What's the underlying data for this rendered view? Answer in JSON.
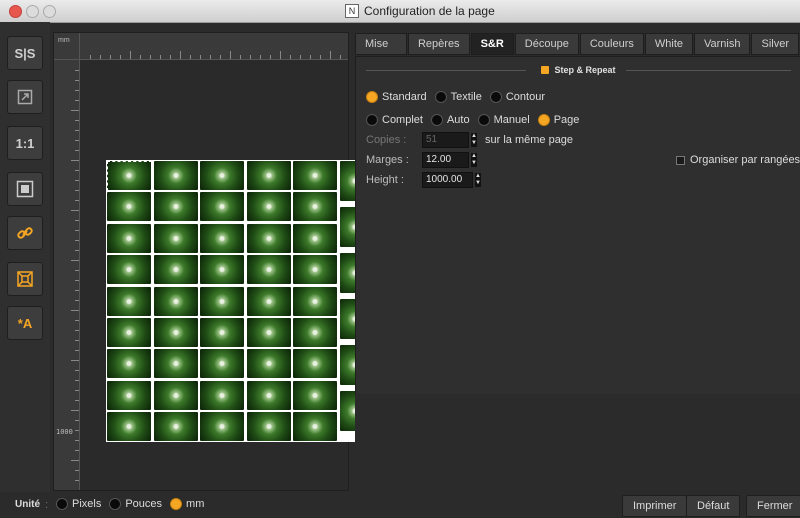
{
  "window": {
    "title": "Configuration de la page",
    "app_icon_glyph": "N"
  },
  "toolbar": {
    "buttons": [
      {
        "name": "split-view-icon",
        "glyph": "S|S",
        "color": "#d0d0d0"
      },
      {
        "name": "export-icon",
        "glyph": "⇱",
        "color": "#aaaaaa"
      },
      {
        "name": "actual-size-icon",
        "glyph": "1:1",
        "color": "#d0d0d0"
      },
      {
        "name": "fit-page-icon",
        "glyph": "▣",
        "color": "#d0d0d0"
      },
      {
        "name": "link-icon",
        "glyph": "🔗",
        "color": "#f5a623"
      },
      {
        "name": "arrange-icon",
        "glyph": "⌘",
        "color": "#f5a623"
      },
      {
        "name": "auto-text-icon",
        "glyph": "*A",
        "color": "#f5a623"
      }
    ]
  },
  "preview": {
    "ruler_unit": "mm",
    "ruler_mark": "1000",
    "grid": {
      "columns": 6,
      "rows": 9,
      "side_tiles": 6
    }
  },
  "tabs": [
    {
      "label": "Mise en page",
      "active": false
    },
    {
      "label": "Repères",
      "active": false
    },
    {
      "label": "S&R",
      "active": true
    },
    {
      "label": "Découpe",
      "active": false
    },
    {
      "label": "Couleurs",
      "active": false
    },
    {
      "label": "White",
      "active": false
    },
    {
      "label": "Varnish",
      "active": false
    },
    {
      "label": "Silver",
      "active": false
    }
  ],
  "sr": {
    "section_title": "Step & Repeat",
    "mode_options": [
      {
        "label": "Standard",
        "selected": true
      },
      {
        "label": "Textile",
        "selected": false
      },
      {
        "label": "Contour",
        "selected": false
      }
    ],
    "fill_options": [
      {
        "label": "Complet",
        "selected": false
      },
      {
        "label": "Auto",
        "selected": false
      },
      {
        "label": "Manuel",
        "selected": false
      },
      {
        "label": "Page",
        "selected": true
      }
    ],
    "copies": {
      "label": "Copies",
      "value": "51",
      "suffix": "sur la même page"
    },
    "marges": {
      "label": "Marges",
      "value": "12.00"
    },
    "height": {
      "label": "Height",
      "value": "1000.00"
    },
    "organiser_label": "Organiser par rangées",
    "organiser_checked": false
  },
  "footer": {
    "unit_label": "Unité",
    "unit_options": [
      {
        "label": "Pixels",
        "selected": false
      },
      {
        "label": "Pouces",
        "selected": false
      },
      {
        "label": "mm",
        "selected": true
      }
    ],
    "print_label": "Imprimer",
    "default_label": "Défaut",
    "close_label": "Fermer"
  },
  "colors": {
    "accent": "#f5a623",
    "panel": "#2f2f2f",
    "background": "#2b2b2b"
  }
}
